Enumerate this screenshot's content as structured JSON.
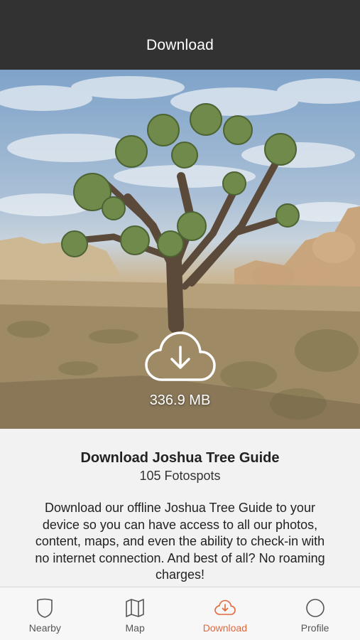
{
  "header": {
    "title": "Download"
  },
  "hero": {
    "download_size": "336.9 MB"
  },
  "info": {
    "title": "Download Joshua Tree Guide",
    "subtitle": "105 Fotospots",
    "description": "Download our offline Joshua Tree Guide to your device so you can have access to all our photos, content, maps, and even the ability to check-in with no internet connection. And best of all? No roaming charges!"
  },
  "tabs": [
    {
      "label": "Nearby",
      "icon": "shield-icon",
      "active": false
    },
    {
      "label": "Map",
      "icon": "map-icon",
      "active": false
    },
    {
      "label": "Download",
      "icon": "cloud-download-icon",
      "active": true
    },
    {
      "label": "Profile",
      "icon": "profile-icon",
      "active": false
    }
  ],
  "colors": {
    "header_bg": "#323232",
    "accent": "#e2683c",
    "tab_inactive": "#555555"
  }
}
